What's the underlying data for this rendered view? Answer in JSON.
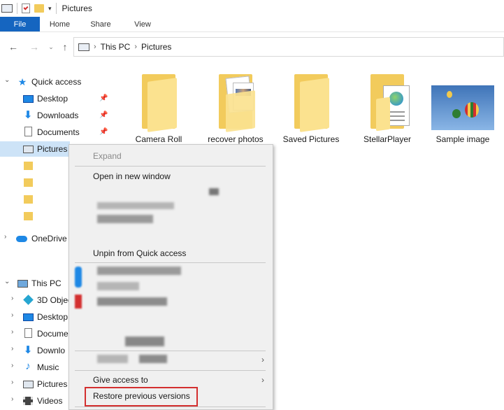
{
  "window": {
    "title": "Pictures"
  },
  "ribbon": {
    "tabs": [
      {
        "label": "File"
      },
      {
        "label": "Home"
      },
      {
        "label": "Share"
      },
      {
        "label": "View"
      }
    ]
  },
  "address": {
    "crumbs": [
      "This PC",
      "Pictures"
    ]
  },
  "nav": {
    "quick_access": "Quick access",
    "desktop": "Desktop",
    "downloads": "Downloads",
    "documents": "Documents",
    "pictures": "Pictures",
    "onedrive": "OneDrive",
    "this_pc": "This PC",
    "pc_3d": "3D Objec",
    "pc_desktop": "Desktop",
    "pc_documents": "Docume",
    "pc_downloads": "Downlo",
    "pc_music": "Music",
    "pc_pictures": "Pictures",
    "pc_videos": "Videos"
  },
  "files": [
    {
      "label": "Camera Roll",
      "icon": "folder-icon"
    },
    {
      "label": "recover photos",
      "icon": "folder-icon"
    },
    {
      "label": "Saved Pictures",
      "icon": "folder-icon"
    },
    {
      "label": "StellarPlayer",
      "icon": "folder-icon"
    },
    {
      "label": "Sample image",
      "icon": "image-thumbnail"
    }
  ],
  "context_menu": {
    "expand": "Expand",
    "open_new_window": "Open in new window",
    "unpin": "Unpin from Quick access",
    "give_access": "Give access to",
    "restore": "Restore previous versions"
  },
  "colors": {
    "accent": "#1565c0",
    "selection": "#cde3f7",
    "highlight": "#d32f2f",
    "folder": "#f2cb5c"
  }
}
